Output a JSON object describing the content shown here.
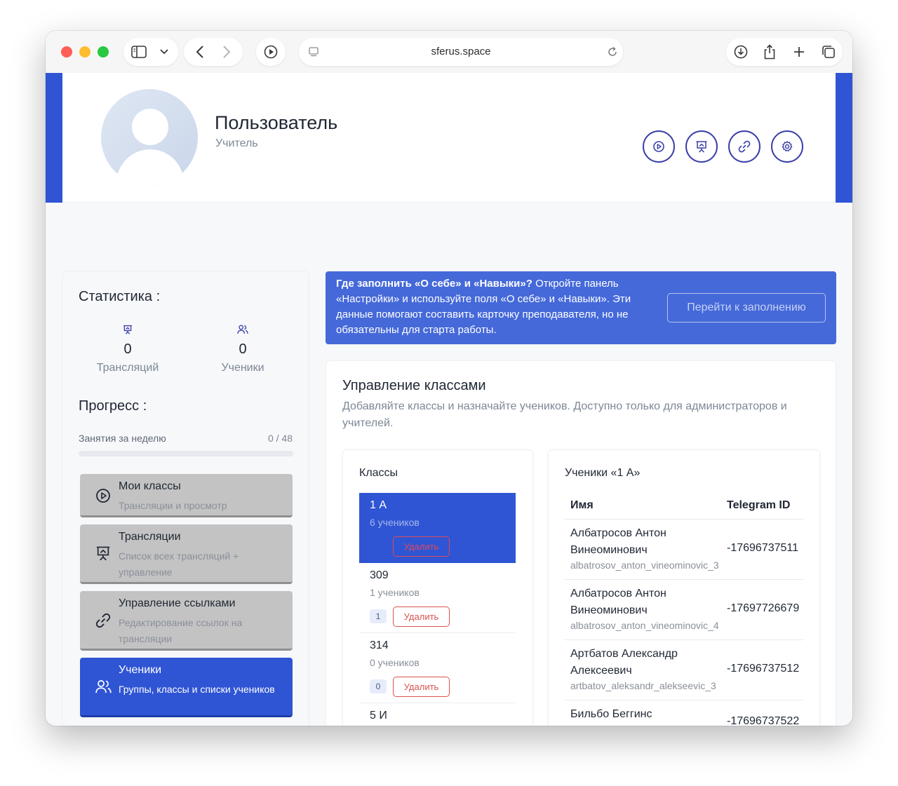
{
  "browser": {
    "address": "sferus.space"
  },
  "profile": {
    "name": "Пользователь",
    "role": "Учитель",
    "actions": [
      "play-circle-icon",
      "presentation-icon",
      "link-icon",
      "gear-icon"
    ]
  },
  "stats": {
    "title": "Статистика :",
    "broadcasts": {
      "value": "0",
      "label": "Трансляций",
      "icon": "presentation-icon"
    },
    "students": {
      "value": "0",
      "label": "Ученики",
      "icon": "users-icon"
    }
  },
  "progress": {
    "title": "Прогресс :",
    "label": "Занятия за неделю",
    "value_text": "0 / 48",
    "done": 0,
    "total": 48,
    "fraction": 0
  },
  "menu": {
    "items": [
      {
        "title": "Мои классы",
        "desc": "Трансляции и просмотр",
        "icon": "play-circle-icon",
        "active": false
      },
      {
        "title": "Трансляции",
        "desc": "Список всех трансляций + управление",
        "icon": "presentation-icon",
        "active": false
      },
      {
        "title": "Управление ссылками",
        "desc": "Редактирование ссылок на трансляции",
        "icon": "link-icon",
        "active": false
      },
      {
        "title": "Ученики",
        "desc": "Группы, классы и списки учеников",
        "icon": "users-icon",
        "active": true
      }
    ]
  },
  "banner": {
    "bold": "Где заполнить «О себе» и «Навыки»?",
    "text": " Откройте панель «Настройки» и используйте поля «О себе» и «Навыки». Эти данные помогают составить карточку преподавателя, но не обязательны для старта работы.",
    "button": "Перейти к заполнению"
  },
  "manage": {
    "title": "Управление классами",
    "desc": "Добавляйте классы и назначайте учеников. Доступно только для администраторов и учителей.",
    "classes_title": "Классы",
    "delete_label": "Удалить",
    "classes": [
      {
        "name": "1 А",
        "count": "6 учеников",
        "badge": "",
        "active": true
      },
      {
        "name": "309",
        "count": "1 учеников",
        "badge": "1",
        "active": false
      },
      {
        "name": "314",
        "count": "0 учеников",
        "badge": "0",
        "active": false
      },
      {
        "name": "5 И",
        "count": "",
        "badge": "",
        "active": false
      }
    ],
    "students_title": "Ученики «1 А»",
    "columns": [
      "Имя",
      "Telegram ID"
    ],
    "students": [
      {
        "name": "Албатросов Антон Винеоминович",
        "username": "albatrosov_anton_vineominovic_3",
        "tg": "-17696737511"
      },
      {
        "name": "Албатросов Антон Винеоминович",
        "username": "albatrosov_anton_vineominovic_4",
        "tg": "-17697726679"
      },
      {
        "name": "Артбатов Александр Алексеевич",
        "username": "artbatov_aleksandr_alekseevic_3",
        "tg": "-17696737512"
      },
      {
        "name": "Бильбо Беггинс",
        "username": "",
        "tg": "-17696737522"
      }
    ]
  }
}
